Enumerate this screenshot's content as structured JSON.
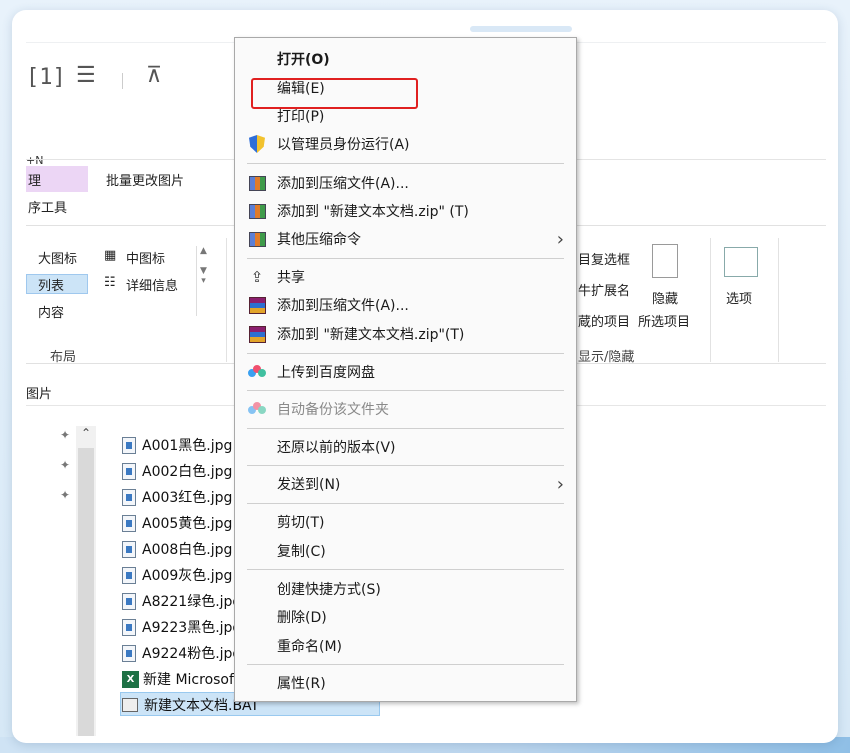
{
  "ribbon": {
    "tab_manage": "理",
    "tab_tools": "序工具",
    "tab_batch": "批量更改图片",
    "view_large": "大图标",
    "view_medium": "中图标",
    "view_list": "列表",
    "view_details": "详细信息",
    "view_content": "内容",
    "group_layout": "布局",
    "right_checkbox": "目复选框",
    "right_ext": "牛扩展名",
    "right_hidden_items": "蔵的项目",
    "hide_selected_line1": "隐藏",
    "hide_selected_line2": "所选项目",
    "options": "选项",
    "group_showhide": "显示/隐藏",
    "partial_shortcut": "+N"
  },
  "toolbar": {
    "icon1": "[1]",
    "icon2": "☰",
    "icon3": "⊼"
  },
  "address": {
    "text": "图片"
  },
  "files": [
    {
      "name": "A001黑色.jpg"
    },
    {
      "name": "A002白色.jpg"
    },
    {
      "name": "A003红色.jpg"
    },
    {
      "name": "A005黄色.jpg"
    },
    {
      "name": "A008白色.jpg"
    },
    {
      "name": "A009灰色.jpg"
    },
    {
      "name": "A8221绿色.jpg"
    },
    {
      "name": "A9223黑色.jpg"
    },
    {
      "name": "A9224粉色.jpg"
    },
    {
      "name": "新建 Microsoft"
    },
    {
      "name": "新建文本文档.BAT"
    }
  ],
  "context_menu": {
    "open": "打开(O)",
    "edit": "编辑(E)",
    "print": "打印(P)",
    "run_as_admin": "以管理员身份运行(A)",
    "add_to_archive_360": "添加到压缩文件(A)...",
    "add_to_zip_360": "添加到 \"新建文本文档.zip\" (T)",
    "other_commands": "其他压缩命令",
    "share": "共享",
    "add_to_archive_rar": "添加到压缩文件(A)...",
    "add_to_zip_rar": "添加到 \"新建文本文档.zip\"(T)",
    "upload_baidu": "上传到百度网盘",
    "auto_backup": "自动备份该文件夹",
    "restore_prev": "还原以前的版本(V)",
    "send_to": "发送到(N)",
    "cut": "剪切(T)",
    "copy": "复制(C)",
    "create_shortcut": "创建快捷方式(S)",
    "delete": "删除(D)",
    "rename": "重命名(M)",
    "properties": "属性(R)"
  },
  "colors": {
    "highlight_box": "#e02020",
    "selection": "#cce4f7",
    "context_tab": "#ecd6f5"
  }
}
